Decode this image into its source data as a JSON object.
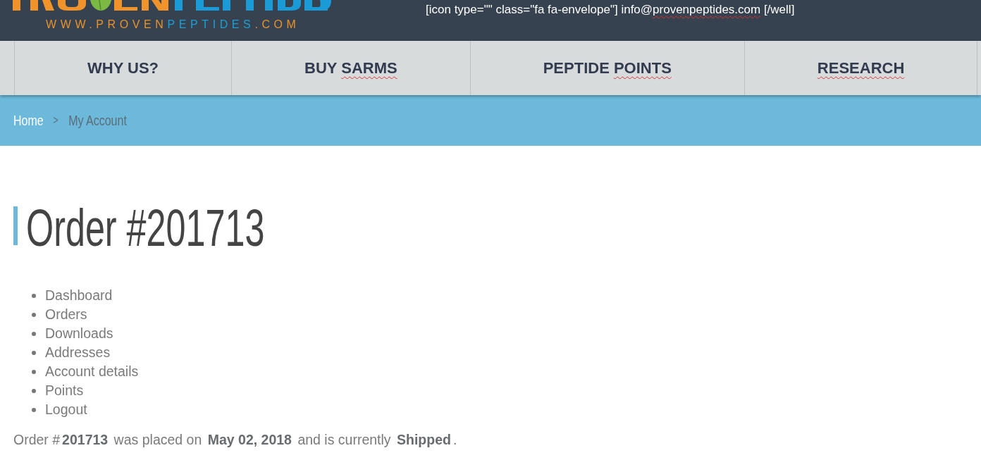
{
  "header": {
    "logo": {
      "tagline": [
        {
          "text": "WWW.PROVEN",
          "color": "#e8922e"
        },
        {
          "text": "PEPTIDES",
          "color": "#1d9fd6"
        },
        {
          "text": ".COM",
          "color": "#e8922e"
        }
      ]
    },
    "contact": [
      {
        "text": "[icon type=\"\" class=\"fa fa-envelope\"] info@",
        "flagged": false
      },
      {
        "text": "provenpeptides.com",
        "flagged": true
      },
      {
        "text": " [/well]",
        "flagged": false
      }
    ]
  },
  "nav": [
    {
      "parts": [
        {
          "text": "WHY US?",
          "flagged": false
        }
      ]
    },
    {
      "parts": [
        {
          "text": "BUY ",
          "flagged": false
        },
        {
          "text": "SARMS",
          "flagged": true
        }
      ]
    },
    {
      "parts": [
        {
          "text": "PEPTIDE ",
          "flagged": false
        },
        {
          "text": "POINTS",
          "flagged": true
        }
      ]
    },
    {
      "parts": [
        {
          "text": "RESEARCH",
          "flagged": true
        }
      ]
    }
  ],
  "breadcrumb": {
    "items": [
      {
        "label": "Home",
        "current": false
      },
      {
        "label": "My Account",
        "current": true
      }
    ],
    "separator": ">"
  },
  "title": "Order #201713",
  "account_nav": [
    "Dashboard",
    "Orders",
    "Downloads",
    "Addresses",
    "Account details",
    "Points",
    "Logout"
  ],
  "order_summary": "Order #**201713** was placed on **May 02, 2018** and is currently **Shipped**."
}
